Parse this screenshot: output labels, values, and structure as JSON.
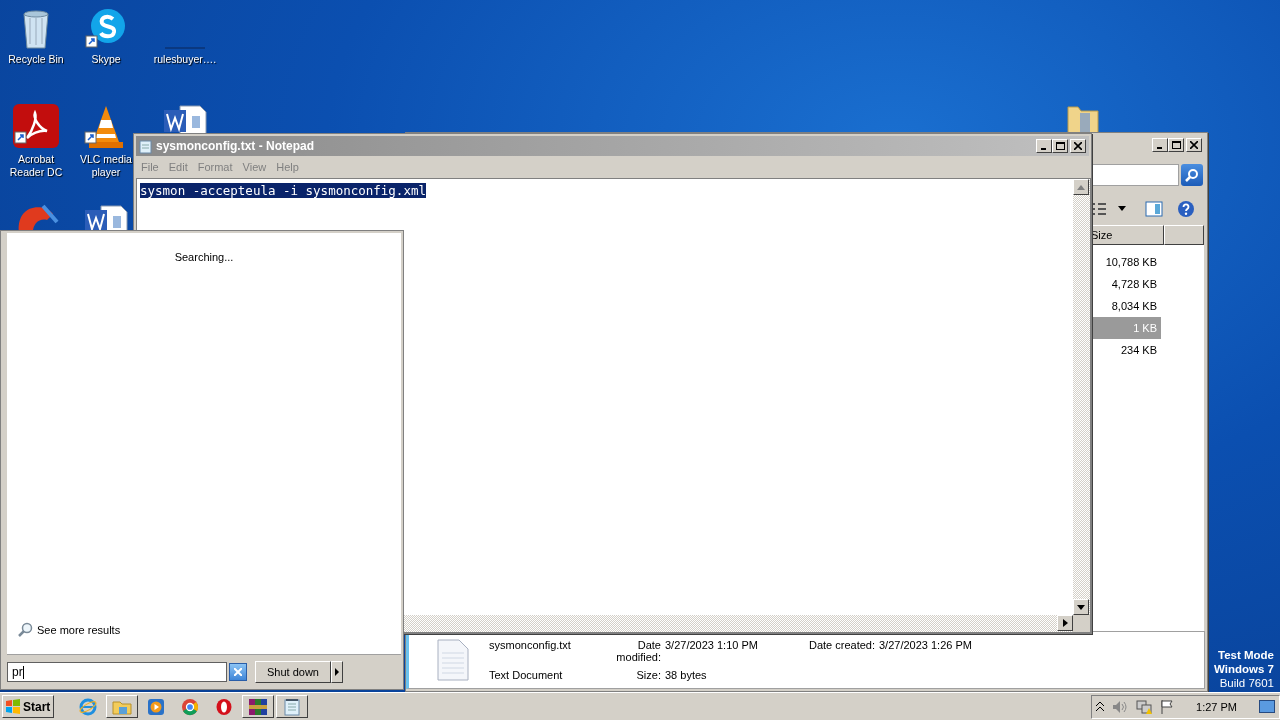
{
  "desktop_icons": [
    {
      "kind": "recycle",
      "label": "Recycle Bin"
    },
    {
      "kind": "skype",
      "label": "Skype"
    },
    {
      "kind": "blank",
      "label": "rulesbuyer…."
    },
    {
      "kind": "acrobat",
      "label": "Acrobat Reader DC"
    },
    {
      "kind": "vlc",
      "label": "VLC media player"
    },
    {
      "kind": "word"
    },
    {
      "kind": "ccleaner"
    },
    {
      "kind": "word"
    }
  ],
  "notepad": {
    "title": "sysmonconfig.txt - Notepad",
    "menu": [
      "File",
      "Edit",
      "Format",
      "View",
      "Help"
    ],
    "text": "sysmon -accepteula -i sysmonconfig.xml",
    "text_selected": true
  },
  "explorer": {
    "size_column": "Size",
    "sizes": [
      {
        "text": "10,788 KB",
        "selected": false
      },
      {
        "text": "4,728 KB",
        "selected": false
      },
      {
        "text": "8,034 KB",
        "selected": false
      },
      {
        "text": "1 KB",
        "selected": true
      },
      {
        "text": "234 KB",
        "selected": false
      }
    ],
    "details": {
      "name": "sysmonconfig.txt",
      "type": "Text Document",
      "modified_label": "Date modified:",
      "modified": "3/27/2023 1:10 PM",
      "size_label": "Size:",
      "size": "38 bytes",
      "created_label": "Date created:",
      "created": "3/27/2023 1:26 PM"
    }
  },
  "start_menu": {
    "status": "Searching...",
    "see_more": "See more results",
    "search_value": "pr",
    "shutdown": "Shut down"
  },
  "taskbar": {
    "start": "Start",
    "apps": [
      {
        "kind": "ie",
        "running": false
      },
      {
        "kind": "explorer",
        "running": true
      },
      {
        "kind": "media",
        "running": false
      },
      {
        "kind": "chrome",
        "running": false
      },
      {
        "kind": "opera",
        "running": false
      },
      {
        "kind": "winrar",
        "running": true
      },
      {
        "kind": "notepad",
        "running": true
      }
    ],
    "time": "1:27 PM"
  },
  "os_notice": [
    "Test Mode",
    "Windows 7",
    "Build 7601"
  ]
}
